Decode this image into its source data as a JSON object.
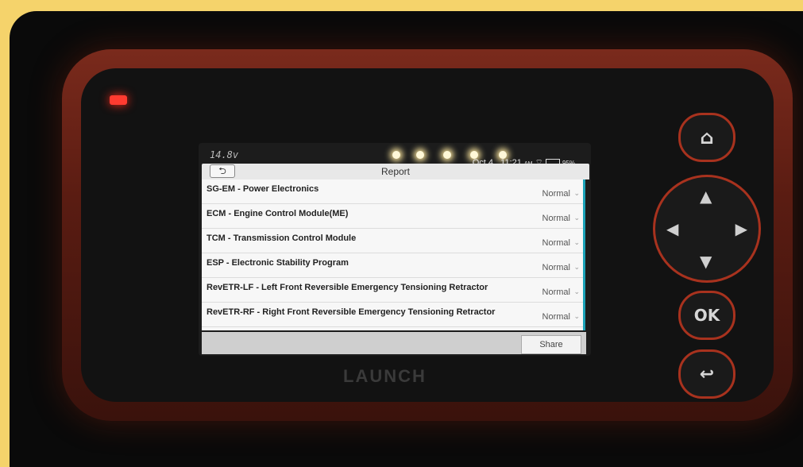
{
  "status": {
    "voltage": "14.8v",
    "date": "Oct 4",
    "time": "11:21",
    "ampm": "AM",
    "battery": "95%"
  },
  "header": {
    "title": "Report",
    "back_icon": "back-arrow-icon"
  },
  "rows": [
    {
      "name": "SG-EM - Power Electronics",
      "status": "Normal"
    },
    {
      "name": "ECM - Engine Control Module(ME)",
      "status": "Normal"
    },
    {
      "name": "TCM - Transmission Control Module",
      "status": "Normal"
    },
    {
      "name": "ESP - Electronic Stability Program",
      "status": "Normal"
    },
    {
      "name": "RevETR-LF - Left Front Reversible Emergency Tensioning Retractor",
      "status": "Normal"
    },
    {
      "name": "RevETR-RF - Right Front Reversible Emergency Tensioning Retractor",
      "status": "Normal"
    }
  ],
  "footer": {
    "share_label": "Share"
  },
  "device": {
    "brand": "LAUNCH",
    "ok_label": "OK"
  },
  "colors": {
    "accent": "#1ba3b8",
    "frame": "#f5d36b",
    "bezel": "#7a2a1c",
    "led": "#ff3b30"
  }
}
